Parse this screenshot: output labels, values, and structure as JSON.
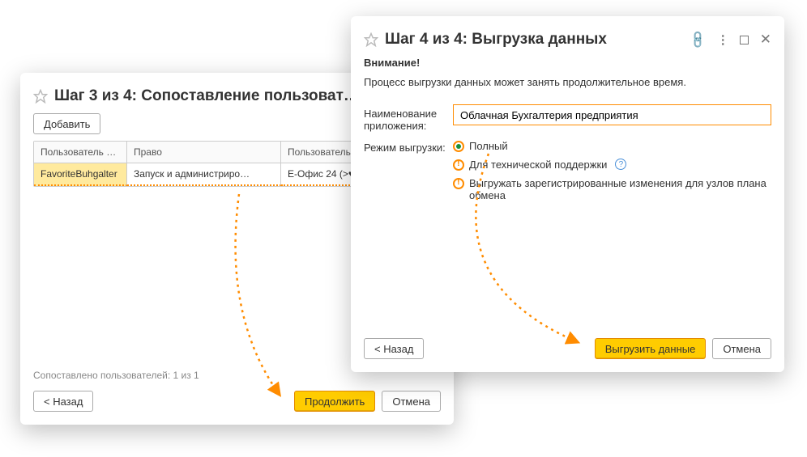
{
  "step3": {
    "title": "Шаг 3 из 4: Сопоставление пользоват…",
    "add_button": "Добавить",
    "columns": {
      "user": "Пользователь …",
      "right": "Право",
      "svc_user": "Пользователь …"
    },
    "row": {
      "user": "FavoriteBuhgalter",
      "right": "Запуск и администриро…",
      "svc_user": "Е-Офис 24 (>♥"
    },
    "status": "Сопоставлено пользователей: 1 из 1",
    "back": "< Назад",
    "continue": "Продолжить",
    "cancel": "Отмена"
  },
  "step4": {
    "title": "Шаг 4 из 4: Выгрузка данных",
    "attention": "Внимание!",
    "desc": "Процесс выгрузки данных может занять продолжительное время.",
    "app_name_label": "Наименование приложения:",
    "app_name_value": "Облачная Бухгалтерия предприятия",
    "mode_label": "Режим выгрузки:",
    "mode_full": "Полный",
    "mode_support": "Для технической поддержки",
    "mode_changes": "Выгружать зарегистрированные изменения для узлов плана обмена",
    "back": "< Назад",
    "export": "Выгрузить данные",
    "cancel": "Отмена"
  }
}
